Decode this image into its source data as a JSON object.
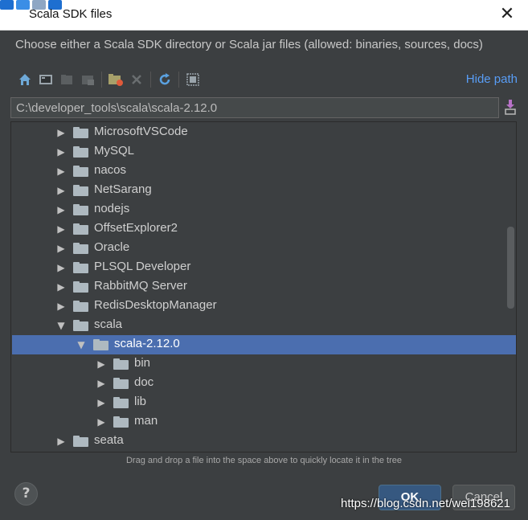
{
  "window": {
    "title": "Scala SDK files",
    "close_label": "✕"
  },
  "description": "Choose either a Scala SDK directory or Scala jar files (allowed: binaries, sources, docs)",
  "toolbar": {
    "hide_path_label": "Hide path",
    "icons": [
      "home-icon",
      "desktop-icon",
      "project-icon",
      "module-icon",
      "new-folder-icon",
      "delete-icon",
      "refresh-icon",
      "show-hidden-icon"
    ]
  },
  "path_field": {
    "value": "C:\\developer_tools\\scala\\scala-2.12.0"
  },
  "tree": {
    "items": [
      {
        "label": "MicrosoftVSCode",
        "expanded": false,
        "level": 0,
        "selected": false
      },
      {
        "label": "MySQL",
        "expanded": false,
        "level": 0,
        "selected": false
      },
      {
        "label": "nacos",
        "expanded": false,
        "level": 0,
        "selected": false
      },
      {
        "label": "NetSarang",
        "expanded": false,
        "level": 0,
        "selected": false
      },
      {
        "label": "nodejs",
        "expanded": false,
        "level": 0,
        "selected": false
      },
      {
        "label": "OffsetExplorer2",
        "expanded": false,
        "level": 0,
        "selected": false
      },
      {
        "label": "Oracle",
        "expanded": false,
        "level": 0,
        "selected": false
      },
      {
        "label": "PLSQL Developer",
        "expanded": false,
        "level": 0,
        "selected": false
      },
      {
        "label": "RabbitMQ Server",
        "expanded": false,
        "level": 0,
        "selected": false
      },
      {
        "label": "RedisDesktopManager",
        "expanded": false,
        "level": 0,
        "selected": false
      },
      {
        "label": "scala",
        "expanded": true,
        "level": 0,
        "selected": false
      },
      {
        "label": "scala-2.12.0",
        "expanded": true,
        "level": 1,
        "selected": true
      },
      {
        "label": "bin",
        "expanded": false,
        "level": 2,
        "selected": false
      },
      {
        "label": "doc",
        "expanded": false,
        "level": 2,
        "selected": false
      },
      {
        "label": "lib",
        "expanded": false,
        "level": 2,
        "selected": false
      },
      {
        "label": "man",
        "expanded": false,
        "level": 2,
        "selected": false
      },
      {
        "label": "seata",
        "expanded": false,
        "level": 0,
        "selected": false
      }
    ]
  },
  "hint": "Drag and drop a file into the space above to quickly locate it in the tree",
  "buttons": {
    "help": "?",
    "ok": "OK",
    "cancel": "Cancel"
  },
  "watermark": "https://blog.csdn.net/wei198621",
  "colors": {
    "background": "#3c3f41",
    "selection": "#4b6eaf",
    "link": "#589df6",
    "folder": "#aeb9c0"
  }
}
